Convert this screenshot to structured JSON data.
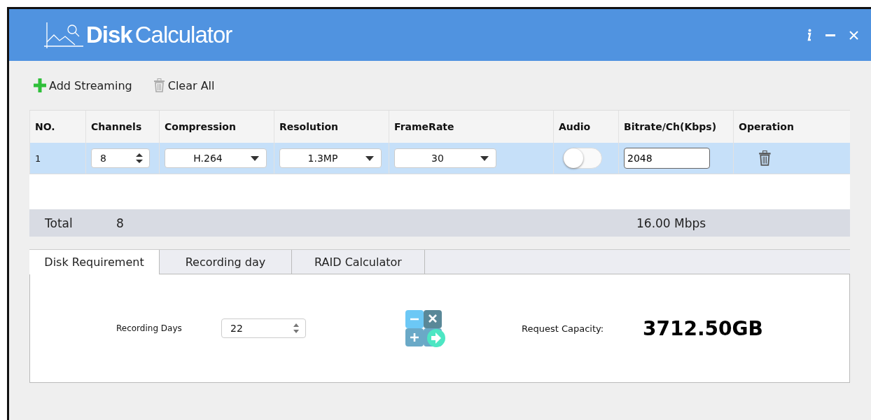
{
  "window": {
    "title_bold": "Disk",
    "title_light": "Calculator"
  },
  "toolbar": [
    {
      "kind": "add",
      "label": "Add Streaming"
    },
    {
      "kind": "clear",
      "label": "Clear All"
    }
  ],
  "table": {
    "columns": [
      "NO.",
      "Channels",
      "Compression",
      "Resolution",
      "FrameRate",
      "Audio",
      "Bitrate/Ch(Kbps)",
      "Operation"
    ],
    "rows": [
      {
        "no": "1",
        "channels": "8",
        "compression": "H.264",
        "resolution": "1.3MP",
        "framerate": "30",
        "audio_on": false,
        "bitrate": "2048",
        "selected": true
      }
    ]
  },
  "total": {
    "label": "Total",
    "channels": "8",
    "bitrate": "16.00 Mbps"
  },
  "tabs": [
    {
      "label": "Disk Requirement",
      "selected": true
    },
    {
      "label": "Recording day",
      "selected": false
    },
    {
      "label": "RAID Calculator",
      "selected": false
    }
  ],
  "panel": {
    "days_label": "Recording Days",
    "days_value": "22",
    "capacity_label": "Request Capacity:",
    "capacity_value": "3712.50GB"
  }
}
